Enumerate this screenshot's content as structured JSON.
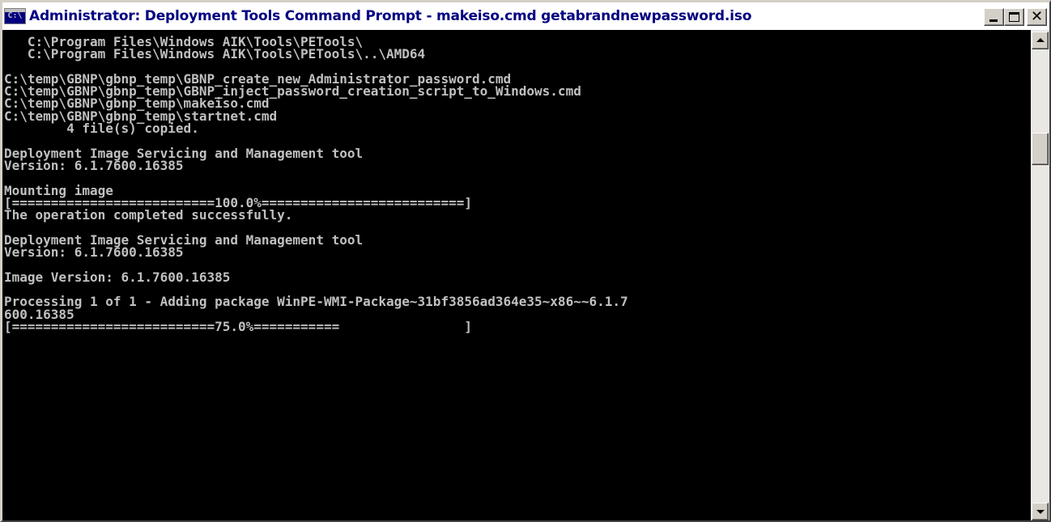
{
  "window": {
    "title": "Administrator: Deployment Tools Command Prompt - makeiso.cmd  getabrandnewpassword.iso",
    "icon": "cmd-icon",
    "icon_text": "C:\\",
    "controls": {
      "minimize": "minimize-icon",
      "maximize": "maximize-icon",
      "close_glyph": "✕"
    }
  },
  "console": {
    "lines": [
      "   C:\\Program Files\\Windows AIK\\Tools\\PETools\\",
      "   C:\\Program Files\\Windows AIK\\Tools\\PETools\\..\\AMD64",
      "",
      "C:\\temp\\GBNP\\gbnp_temp\\GBNP_create_new_Administrator_password.cmd",
      "C:\\temp\\GBNP\\gbnp_temp\\GBNP_inject_password_creation_script_to_Windows.cmd",
      "C:\\temp\\GBNP\\gbnp_temp\\makeiso.cmd",
      "C:\\temp\\GBNP\\gbnp_temp\\startnet.cmd",
      "        4 file(s) copied.",
      "",
      "Deployment Image Servicing and Management tool",
      "Version: 6.1.7600.16385",
      "",
      "Mounting image",
      "[==========================100.0%==========================]",
      "The operation completed successfully.",
      "",
      "Deployment Image Servicing and Management tool",
      "Version: 6.1.7600.16385",
      "",
      "Image Version: 6.1.7600.16385",
      "",
      "Processing 1 of 1 - Adding package WinPE-WMI-Package~31bf3856ad364e35~x86~~6.1.7",
      "600.16385",
      "[==========================75.0%===========                ]"
    ]
  },
  "colors": {
    "console_background": "#000000",
    "console_text": "#c0c0c0",
    "title_text": "#000080"
  }
}
